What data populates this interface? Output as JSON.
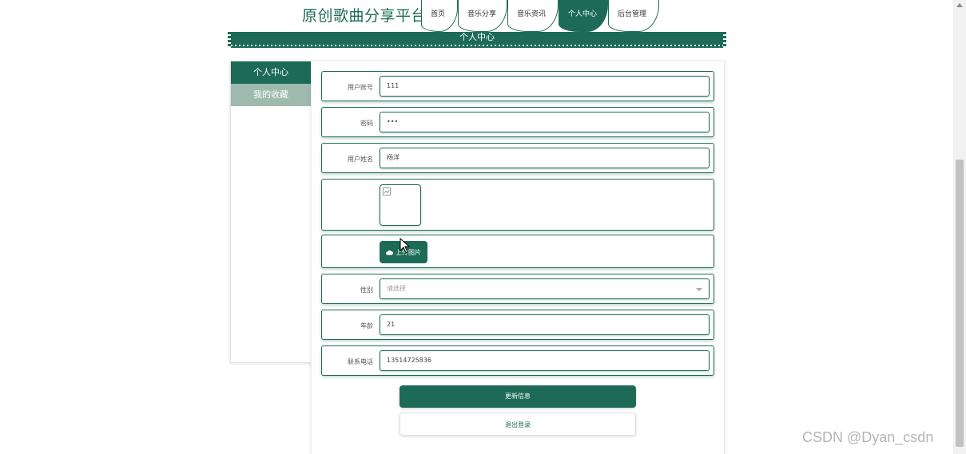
{
  "header": {
    "site_title": "原创歌曲分享平台",
    "nav": [
      {
        "label": "首页",
        "active": false
      },
      {
        "label": "音乐分享",
        "active": false
      },
      {
        "label": "音乐资讯",
        "active": false
      },
      {
        "label": "个人中心",
        "active": true
      },
      {
        "label": "后台管理",
        "active": false
      }
    ]
  },
  "banner": {
    "title": "个人中心"
  },
  "sidebar": {
    "items": [
      {
        "label": "个人中心",
        "active": true
      },
      {
        "label": "我的收藏",
        "active": false
      }
    ]
  },
  "form": {
    "username": {
      "label": "用户账号",
      "value": "111"
    },
    "password": {
      "label": "密码",
      "value": "•••"
    },
    "fullname": {
      "label": "用户姓名",
      "value": "杨洋"
    },
    "upload_button": "上传图片",
    "gender": {
      "label": "性别",
      "placeholder": "请选择"
    },
    "age": {
      "label": "年龄",
      "value": "21"
    },
    "phone": {
      "label": "联系电话",
      "value": "13514725836"
    }
  },
  "actions": {
    "update": "更新信息",
    "logout": "退出登录"
  },
  "watermark": "CSDN @Dyan_csdn",
  "colors": {
    "accent": "#1d6b57",
    "sidebar_alt": "#9eb9ad"
  }
}
